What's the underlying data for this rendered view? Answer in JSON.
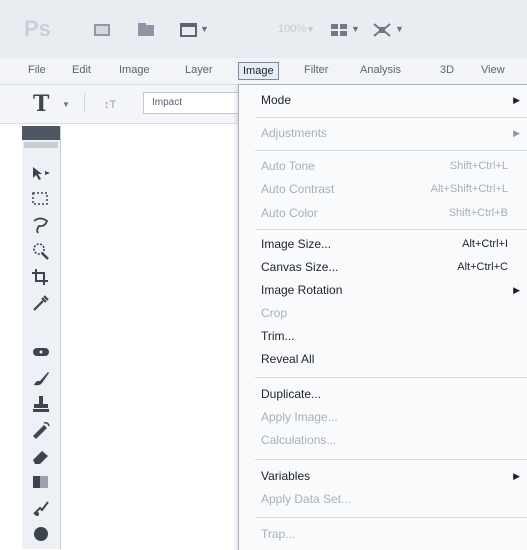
{
  "app": {
    "logo": "Ps",
    "zoom_value": "100%"
  },
  "menubar": {
    "items": [
      {
        "label": "File"
      },
      {
        "label": "Edit"
      },
      {
        "label": "Image"
      },
      {
        "label": "Layer"
      },
      {
        "label": "Image"
      },
      {
        "label": "Filter"
      },
      {
        "label": "Analysis"
      },
      {
        "label": "3D"
      },
      {
        "label": "View"
      }
    ]
  },
  "options": {
    "tool_glyph": "T",
    "font_family": "Impact"
  },
  "menu": {
    "items": [
      {
        "label": "Mode",
        "shortcut": "",
        "submenu": true,
        "enabled": true
      },
      {
        "label": "Adjustments",
        "shortcut": "",
        "submenu": true,
        "enabled": false
      },
      {
        "label": "Auto Tone",
        "shortcut": "Shift+Ctrl+L",
        "submenu": false,
        "enabled": false
      },
      {
        "label": "Auto Contrast",
        "shortcut": "Alt+Shift+Ctrl+L",
        "submenu": false,
        "enabled": false
      },
      {
        "label": "Auto Color",
        "shortcut": "Shift+Ctrl+B",
        "submenu": false,
        "enabled": false
      },
      {
        "label": "Image Size...",
        "shortcut": "Alt+Ctrl+I",
        "submenu": false,
        "enabled": true
      },
      {
        "label": "Canvas Size...",
        "shortcut": "Alt+Ctrl+C",
        "submenu": false,
        "enabled": true
      },
      {
        "label": "Image Rotation",
        "shortcut": "",
        "submenu": true,
        "enabled": true
      },
      {
        "label": "Crop",
        "shortcut": "",
        "submenu": false,
        "enabled": false
      },
      {
        "label": "Trim...",
        "shortcut": "",
        "submenu": false,
        "enabled": true
      },
      {
        "label": "Reveal All",
        "shortcut": "",
        "submenu": false,
        "enabled": true
      },
      {
        "label": "Duplicate...",
        "shortcut": "",
        "submenu": false,
        "enabled": true
      },
      {
        "label": "Apply Image...",
        "shortcut": "",
        "submenu": false,
        "enabled": false
      },
      {
        "label": "Calculations...",
        "shortcut": "",
        "submenu": false,
        "enabled": false
      },
      {
        "label": "Variables",
        "shortcut": "",
        "submenu": true,
        "enabled": true
      },
      {
        "label": "Apply Data Set...",
        "shortcut": "",
        "submenu": false,
        "enabled": false
      },
      {
        "label": "Trap...",
        "shortcut": "",
        "submenu": false,
        "enabled": false
      }
    ]
  },
  "toolbox": {
    "tools": [
      {
        "icon": "move-tool-icon"
      },
      {
        "icon": "marquee-tool-icon"
      },
      {
        "icon": "lasso-tool-icon"
      },
      {
        "icon": "quick-selection-tool-icon"
      },
      {
        "icon": "crop-tool-icon"
      },
      {
        "icon": "eyedropper-tool-icon"
      },
      {
        "icon": "spot-healing-tool-icon"
      },
      {
        "icon": "brush-tool-icon"
      },
      {
        "icon": "clone-stamp-tool-icon"
      },
      {
        "icon": "history-brush-tool-icon"
      },
      {
        "icon": "eraser-tool-icon"
      },
      {
        "icon": "gradient-tool-icon"
      },
      {
        "icon": "blur-tool-icon"
      },
      {
        "icon": "dodge-tool-icon"
      }
    ]
  },
  "colors": {
    "menu_enabled_text": "#20252c",
    "menu_disabled_text": "#a8afb9",
    "active_menu_bg": "#e7edf7"
  }
}
